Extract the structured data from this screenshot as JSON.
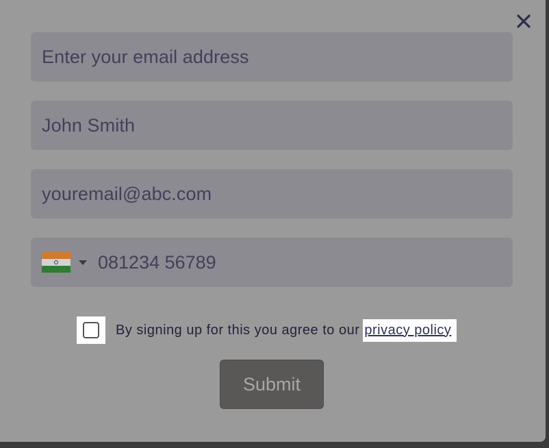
{
  "form": {
    "email_placeholder": "Enter your email address",
    "name_value": "John Smith",
    "email_value": "youremail@abc.com",
    "phone_value": "081234 56789",
    "country_flag": "india-flag-icon"
  },
  "consent": {
    "text": "By signing up for this you agree to our",
    "link_label": "privacy policy",
    "checked": false
  },
  "actions": {
    "submit_label": "Submit",
    "close_icon": "close-icon"
  },
  "colors": {
    "overlay": "#9a9a9a",
    "field_bg": "#8b8b91",
    "text": "#43405a",
    "button_bg": "#5a5856"
  }
}
